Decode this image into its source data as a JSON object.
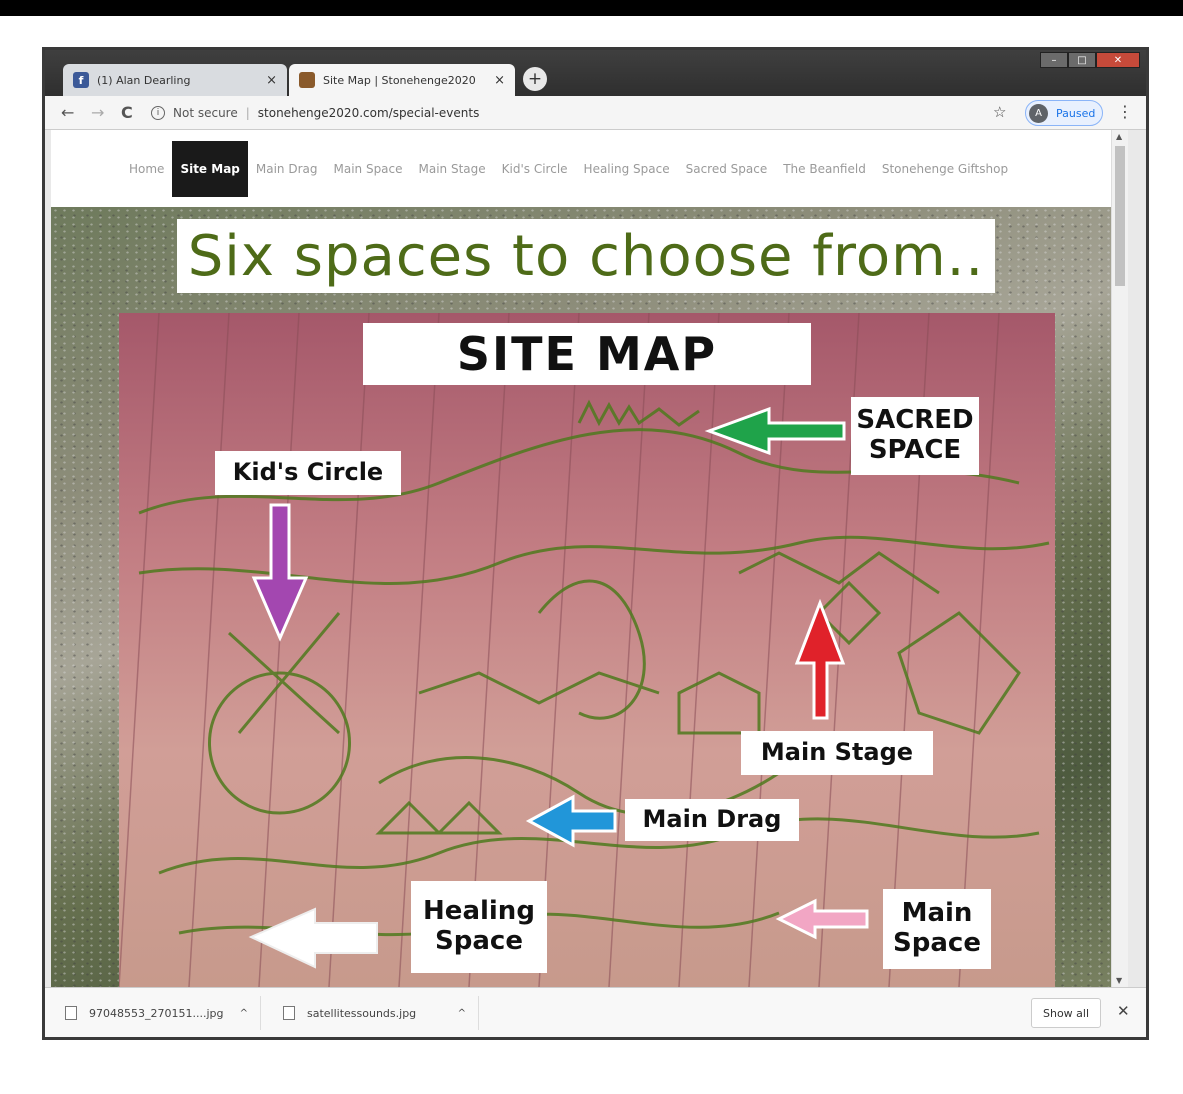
{
  "browser": {
    "tabs": [
      {
        "favicon": "facebook-icon",
        "title": "(1) Alan Dearling",
        "close": "×"
      },
      {
        "favicon": "stonehenge-favicon",
        "title": "Site Map | Stonehenge2020",
        "close": "×"
      }
    ],
    "new_tab": "+",
    "window_controls": {
      "minimize": "–",
      "maximize": "□",
      "close": "✕"
    },
    "nav": {
      "back": "←",
      "forward": "→",
      "reload": "C"
    },
    "security_label": "Not secure",
    "url": "stonehenge2020.com/special-events",
    "bookmark_star": "☆",
    "profile": {
      "initial": "A",
      "status": "Paused"
    },
    "menu": "⋮"
  },
  "site_nav": {
    "items": [
      "Home",
      "Site Map",
      "Main Drag",
      "Main Space",
      "Main Stage",
      "Kid's Circle",
      "Healing Space",
      "Sacred Space",
      "The Beanfield",
      "Stonehenge Giftshop"
    ],
    "active_index": 1
  },
  "headline": "Six spaces to choose from..",
  "map": {
    "title": "SITE MAP",
    "labels": {
      "sacred_1": "SACRED",
      "sacred_2": "SPACE",
      "kids": "Kid's Circle",
      "main_stage": "Main Stage",
      "main_drag": "Main Drag",
      "healing_1": "Healing",
      "healing_2": "Space",
      "main_space_1": "Main",
      "main_space_2": "Space"
    },
    "arrow_colors": {
      "sacred": "#1fa34a",
      "kids": "#a347b0",
      "main_stage": "#e0222a",
      "main_drag": "#2196d9",
      "healing": "#ffffff",
      "main_space": "#f2a6c4"
    },
    "sketch_color": "#4f7a1e"
  },
  "downloads": {
    "items": [
      {
        "name": "97048553_270151....jpg",
        "chevron": "^"
      },
      {
        "name": "satellitessounds.jpg",
        "chevron": "^"
      }
    ],
    "show_all": "Show all",
    "close": "✕"
  }
}
